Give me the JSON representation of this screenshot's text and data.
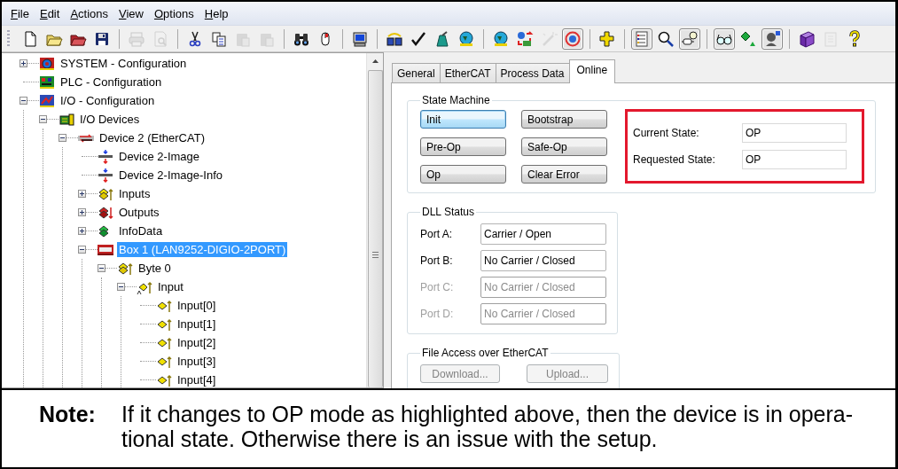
{
  "menu": [
    {
      "label": "File"
    },
    {
      "label": "Edit"
    },
    {
      "label": "Actions"
    },
    {
      "label": "View"
    },
    {
      "label": "Options"
    },
    {
      "label": "Help"
    }
  ],
  "toolbar": [
    {
      "kind": "new",
      "disabled": false,
      "pressed": false
    },
    {
      "kind": "open",
      "disabled": false,
      "pressed": false
    },
    {
      "kind": "open-red",
      "disabled": false,
      "pressed": false
    },
    {
      "kind": "save",
      "disabled": false,
      "pressed": false
    },
    {
      "kind": "separator"
    },
    {
      "kind": "print",
      "disabled": true,
      "pressed": false
    },
    {
      "kind": "preview",
      "disabled": true,
      "pressed": false
    },
    {
      "kind": "separator"
    },
    {
      "kind": "cut",
      "disabled": false,
      "pressed": false
    },
    {
      "kind": "copy",
      "disabled": false,
      "pressed": false
    },
    {
      "kind": "paste",
      "disabled": true,
      "pressed": false
    },
    {
      "kind": "paste",
      "disabled": true,
      "pressed": false
    },
    {
      "kind": "separator"
    },
    {
      "kind": "find",
      "disabled": false,
      "pressed": false
    },
    {
      "kind": "mouse",
      "disabled": false,
      "pressed": false
    },
    {
      "kind": "separator"
    },
    {
      "kind": "monitor",
      "disabled": false,
      "pressed": false
    },
    {
      "kind": "separator"
    },
    {
      "kind": "boxes",
      "disabled": false,
      "pressed": false
    },
    {
      "kind": "check",
      "disabled": false,
      "pressed": false
    },
    {
      "kind": "tower",
      "disabled": false,
      "pressed": false
    },
    {
      "kind": "globe",
      "disabled": false,
      "pressed": false
    },
    {
      "kind": "separator"
    },
    {
      "kind": "globe",
      "disabled": false,
      "pressed": false
    },
    {
      "kind": "arrows",
      "disabled": false,
      "pressed": false
    },
    {
      "kind": "wand",
      "disabled": true,
      "pressed": false
    },
    {
      "kind": "target",
      "disabled": false,
      "pressed": true
    },
    {
      "kind": "separator"
    },
    {
      "kind": "puzzle",
      "disabled": false,
      "pressed": false
    },
    {
      "kind": "separator"
    },
    {
      "kind": "list",
      "disabled": false,
      "pressed": true
    },
    {
      "kind": "search",
      "disabled": false,
      "pressed": false
    },
    {
      "kind": "plug",
      "disabled": false,
      "pressed": true
    },
    {
      "kind": "separator"
    },
    {
      "kind": "glasses",
      "disabled": false,
      "pressed": true
    },
    {
      "kind": "diamond",
      "disabled": false,
      "pressed": false
    },
    {
      "kind": "head",
      "disabled": false,
      "pressed": true
    },
    {
      "kind": "separator"
    },
    {
      "kind": "book",
      "disabled": false,
      "pressed": false
    },
    {
      "kind": "page",
      "disabled": true,
      "pressed": false
    },
    {
      "kind": "help",
      "disabled": false,
      "pressed": false
    }
  ],
  "tree": [
    {
      "label": "SYSTEM - Configuration",
      "kind": "system",
      "expanded": false,
      "selected": false
    },
    {
      "label": "PLC - Configuration",
      "kind": "plc",
      "selected": false
    },
    {
      "label": "I/O - Configuration",
      "kind": "io",
      "expanded": true,
      "selected": false,
      "children": [
        {
          "label": "I/O Devices",
          "kind": "devices",
          "expanded": true,
          "selected": false,
          "children": [
            {
              "label": "Device 2 (EtherCAT)",
              "kind": "ethercat",
              "expanded": true,
              "selected": false,
              "children": [
                {
                  "label": "Device 2-Image",
                  "kind": "image",
                  "selected": false
                },
                {
                  "label": "Device 2-Image-Info",
                  "kind": "image",
                  "selected": false
                },
                {
                  "label": "Inputs",
                  "kind": "inputs",
                  "expanded": false,
                  "selected": false
                },
                {
                  "label": "Outputs",
                  "kind": "outputs",
                  "expanded": false,
                  "selected": false
                },
                {
                  "label": "InfoData",
                  "kind": "infodata",
                  "expanded": false,
                  "selected": false
                },
                {
                  "label": "Box 1 (LAN9252-DIGIO-2PORT)",
                  "kind": "box",
                  "expanded": true,
                  "selected": true,
                  "children": [
                    {
                      "label": "Byte 0",
                      "kind": "byte",
                      "expanded": true,
                      "selected": false,
                      "children": [
                        {
                          "label": "Input",
                          "kind": "input",
                          "expanded": true,
                          "selected": false,
                          "children": [
                            {
                              "label": "Input[0]",
                              "kind": "bit",
                              "selected": false
                            },
                            {
                              "label": "Input[1]",
                              "kind": "bit",
                              "selected": false
                            },
                            {
                              "label": "Input[2]",
                              "kind": "bit",
                              "selected": false
                            },
                            {
                              "label": "Input[3]",
                              "kind": "bit",
                              "selected": false
                            },
                            {
                              "label": "Input[4]",
                              "kind": "bit",
                              "selected": false
                            }
                          ]
                        }
                      ]
                    }
                  ]
                }
              ]
            }
          ]
        }
      ]
    }
  ],
  "tabs": [
    {
      "label": "General",
      "selected": false
    },
    {
      "label": "EtherCAT",
      "selected": false
    },
    {
      "label": "Process Data",
      "selected": false
    },
    {
      "label": "Online",
      "selected": true
    }
  ],
  "state_machine": {
    "title": "State Machine",
    "buttons": [
      {
        "label": "Init",
        "focused": true
      },
      {
        "label": "Bootstrap",
        "focused": false
      },
      {
        "label": "Pre-Op",
        "focused": false
      },
      {
        "label": "Safe-Op",
        "focused": false
      },
      {
        "label": "Op",
        "focused": false
      },
      {
        "label": "Clear Error",
        "focused": false
      }
    ],
    "states": [
      {
        "label": "Current State:",
        "value": "OP"
      },
      {
        "label": "Requested State:",
        "value": "OP"
      }
    ]
  },
  "dll_status": {
    "title": "DLL Status",
    "ports": [
      {
        "label": "Port A:",
        "value": "Carrier / Open",
        "disabled": false
      },
      {
        "label": "Port B:",
        "value": "No Carrier / Closed",
        "disabled": false
      },
      {
        "label": "Port C:",
        "value": "No Carrier / Closed",
        "disabled": true
      },
      {
        "label": "Port D:",
        "value": "No Carrier / Closed",
        "disabled": true
      }
    ]
  },
  "file_access": {
    "title": "File Access over EtherCAT",
    "buttons": [
      {
        "label": "Download...",
        "disabled": true
      },
      {
        "label": "Upload...",
        "disabled": true
      }
    ]
  },
  "note": {
    "label": "Note:",
    "text": "If it changes to OP mode as highlighted above, then the device is in opera-tional state. Otherwise there is an issue with the setup."
  }
}
